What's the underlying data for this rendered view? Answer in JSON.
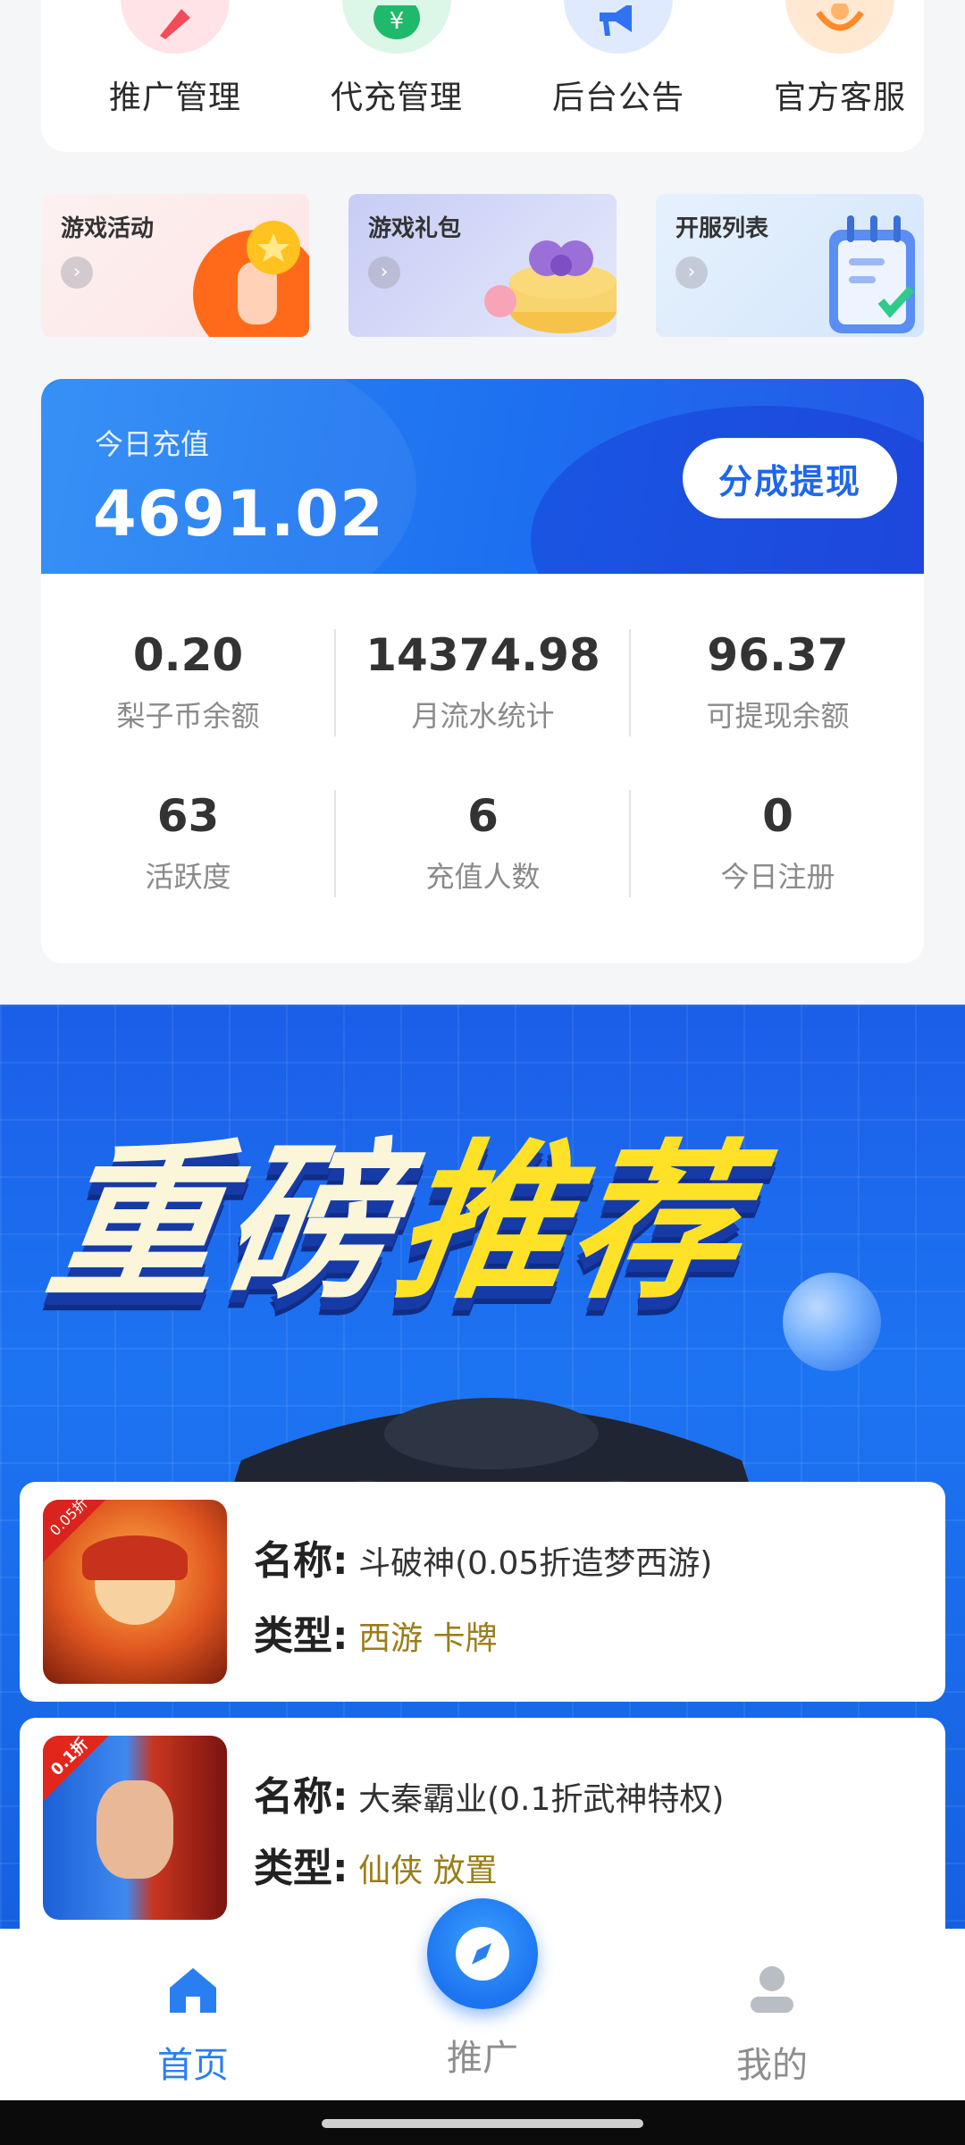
{
  "menu": {
    "items": [
      {
        "label": "推广管理",
        "icon": "rocket-icon",
        "bg": "#ffe3e6",
        "color": "#f24b5b"
      },
      {
        "label": "代充管理",
        "icon": "yuan-coin-icon",
        "bg": "#dcf6e7",
        "color": "#20b86a"
      },
      {
        "label": "后台公告",
        "icon": "megaphone-icon",
        "bg": "#dfeaff",
        "color": "#2f73f2"
      },
      {
        "label": "官方客服",
        "icon": "headset-icon",
        "bg": "#ffe9d3",
        "color": "#ff8a2a"
      }
    ]
  },
  "tiles": [
    {
      "title": "游戏活动",
      "icon": "thumbs-up-coin-icon"
    },
    {
      "title": "游戏礼包",
      "icon": "gift-box-icon"
    },
    {
      "title": "开服列表",
      "icon": "calendar-checklist-icon"
    }
  ],
  "recharge": {
    "label": "今日充值",
    "value": "4691.02",
    "withdraw_label": "分成提现"
  },
  "stats": [
    {
      "value": "0.20",
      "label": "梨子币余额"
    },
    {
      "value": "14374.98",
      "label": "月流水统计"
    },
    {
      "value": "96.37",
      "label": "可提现余额"
    },
    {
      "value": "63",
      "label": "活跃度"
    },
    {
      "value": "6",
      "label": "充值人数"
    },
    {
      "value": "0",
      "label": "今日注册"
    }
  ],
  "promo": {
    "headline_white": "重磅",
    "headline_yellow": "推荐"
  },
  "games": [
    {
      "name_key": "名称:",
      "name": "斗破神(0.05折造梦西游)",
      "type_key": "类型:",
      "type": "西游 卡牌",
      "badge": "0.05折"
    },
    {
      "name_key": "名称:",
      "name": "大秦霸业(0.1折武神特权)",
      "type_key": "类型:",
      "type": "仙侠 放置",
      "badge": "0.1折"
    }
  ],
  "nav": {
    "home": "首页",
    "promote": "推广",
    "mine": "我的",
    "active_color": "#2a7ff0",
    "inactive_color": "#8d8d8d"
  }
}
